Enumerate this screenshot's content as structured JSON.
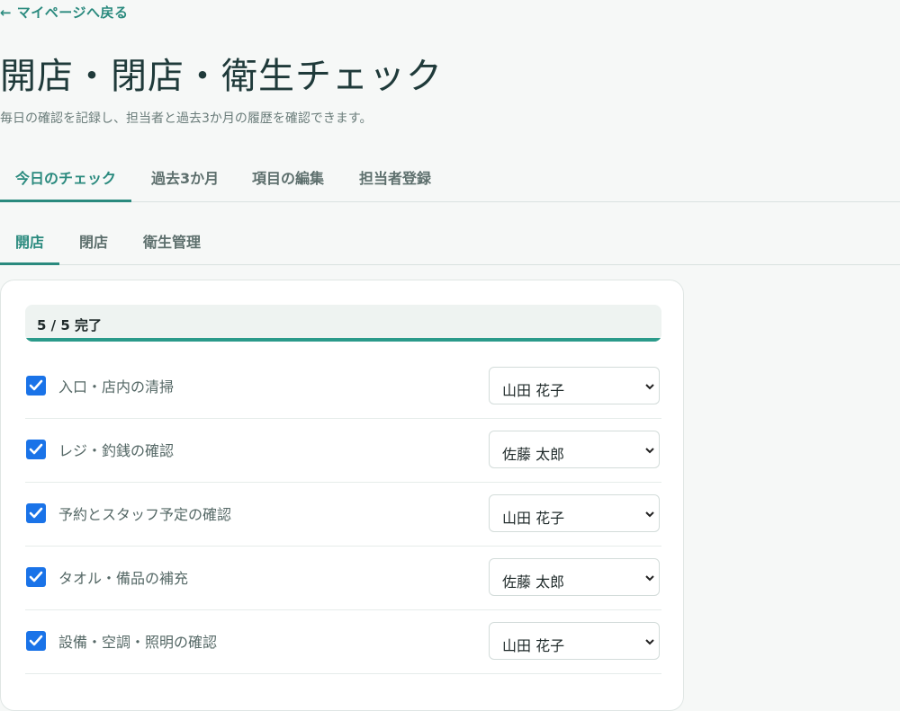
{
  "back_link": "← マイページへ戻る",
  "title": "開店・閉店・衛生チェック",
  "subtitle": "毎日の確認を記録し、担当者と過去3か月の履歴を確認できます。",
  "main_tabs": [
    {
      "label": "今日のチェック",
      "active": true
    },
    {
      "label": "過去3か月",
      "active": false
    },
    {
      "label": "項目の編集",
      "active": false
    },
    {
      "label": "担当者登録",
      "active": false
    }
  ],
  "sub_tabs": [
    {
      "label": "開店",
      "active": true
    },
    {
      "label": "閉店",
      "active": false
    },
    {
      "label": "衛生管理",
      "active": false
    }
  ],
  "progress": {
    "label": "5 / 5 完了",
    "fraction": 1.0
  },
  "items": [
    {
      "label": "入口・店内の清掃",
      "checked": true,
      "assignee": "山田 花子"
    },
    {
      "label": "レジ・釣銭の確認",
      "checked": true,
      "assignee": "佐藤 太郎"
    },
    {
      "label": "予約とスタッフ予定の確認",
      "checked": true,
      "assignee": "山田 花子"
    },
    {
      "label": "タオル・備品の補充",
      "checked": true,
      "assignee": "佐藤 太郎"
    },
    {
      "label": "設備・空調・照明の確認",
      "checked": true,
      "assignee": "山田 花子"
    }
  ],
  "colors": {
    "accent": "#2a8a7e",
    "checkbox": "#1a73e8"
  }
}
